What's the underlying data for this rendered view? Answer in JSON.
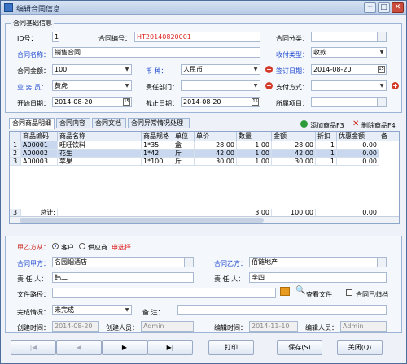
{
  "window": {
    "title": "编辑合同信息",
    "min": "─",
    "max": "□",
    "close": "✕"
  },
  "basic": {
    "legend": "合同基础信息",
    "id_label": "ID号：",
    "id_value": "1",
    "code_label": "合同编号：",
    "code_value": "HT20140820001",
    "category_label": "合同分类：",
    "category_value": "",
    "name_label": "合同名称：",
    "name_value": "销售合同",
    "pay_type_label": "收付类型：",
    "pay_type_value": "收款",
    "amount_label": "合同金额：",
    "amount_value": "100",
    "currency_label": "币    种：",
    "currency_value": "人民币",
    "sign_date_label": "签订日期：",
    "sign_date_value": "2014-08-20",
    "staff_label": "业 务 员：",
    "staff_value": "黄虎",
    "dept_label": "责任部门：",
    "dept_value": "",
    "pay_method_label": "支付方式：",
    "pay_method_value": "",
    "start_label": "开始日期：",
    "start_value": "2014-08-20",
    "end_label": "截止日期：",
    "end_value": "2014-08-20",
    "project_label": "所属项目：",
    "project_value": ""
  },
  "tabs": [
    "合同商品明细",
    "合同内容",
    "合同文档",
    "合同异常情况处理"
  ],
  "toolbar": {
    "add": "添加商品F3",
    "delete": "删除商品F4"
  },
  "grid": {
    "columns": [
      "商品编码",
      "商品名称",
      "商品规格",
      "单位",
      "单价",
      "数量",
      "金额",
      "折扣",
      "优惠金额",
      "备"
    ],
    "rows": [
      {
        "n": "1",
        "code": "A00001",
        "name": "旺旺饮料",
        "spec": "1*35",
        "unit": "盒",
        "price": "28.00",
        "qty": "1.00",
        "amount": "28.00",
        "disc": "1",
        "off": "0.00"
      },
      {
        "n": "2",
        "code": "A00002",
        "name": "花生",
        "spec": "1*42",
        "unit": "斤",
        "price": "42.00",
        "qty": "1.00",
        "amount": "42.00",
        "disc": "1",
        "off": "0.00"
      },
      {
        "n": "3",
        "code": "A00003",
        "name": "苹果",
        "spec": "1*100",
        "unit": "斤",
        "price": "30.00",
        "qty": "1.00",
        "amount": "30.00",
        "disc": "1",
        "off": "0.00"
      }
    ],
    "total": {
      "n": "3",
      "label": "总计:",
      "qty": "3.00",
      "amount": "100.00",
      "off": "0.00"
    }
  },
  "party": {
    "side_label": "甲乙方从：",
    "opt_customer": "客户",
    "opt_supplier": "供应商",
    "hint": "申选择",
    "party_a_label": "合同甲方：",
    "party_a_value": "名园烟酒店",
    "party_b_label": "合同乙方：",
    "party_b_value": "佰链地产",
    "resp_a_label": "责 任 人：",
    "resp_a_value": "韩二",
    "resp_b_label": "责 任 人：",
    "resp_b_value": "李四",
    "file_label": "文件路径：",
    "file_value": "",
    "view_file": "查看文件",
    "archived": "合同已归档",
    "status_label": "完成情况：",
    "status_value": "未完成",
    "note_label": "备    注：",
    "note_value": "",
    "created_time_label": "创建时间：",
    "created_time_value": "2014-08-20",
    "creator_label": "创建人员：",
    "creator_value": "Admin",
    "edit_time_label": "编辑时间：",
    "edit_time_value": "2014-11-10",
    "editor_label": "编辑人员：",
    "editor_value": "Admin"
  },
  "footer": {
    "first": "|◀",
    "prev": "◀",
    "next": "▶",
    "last": "▶|",
    "print": "打印",
    "save": "保存(S)",
    "close": "关闭(Q)"
  }
}
